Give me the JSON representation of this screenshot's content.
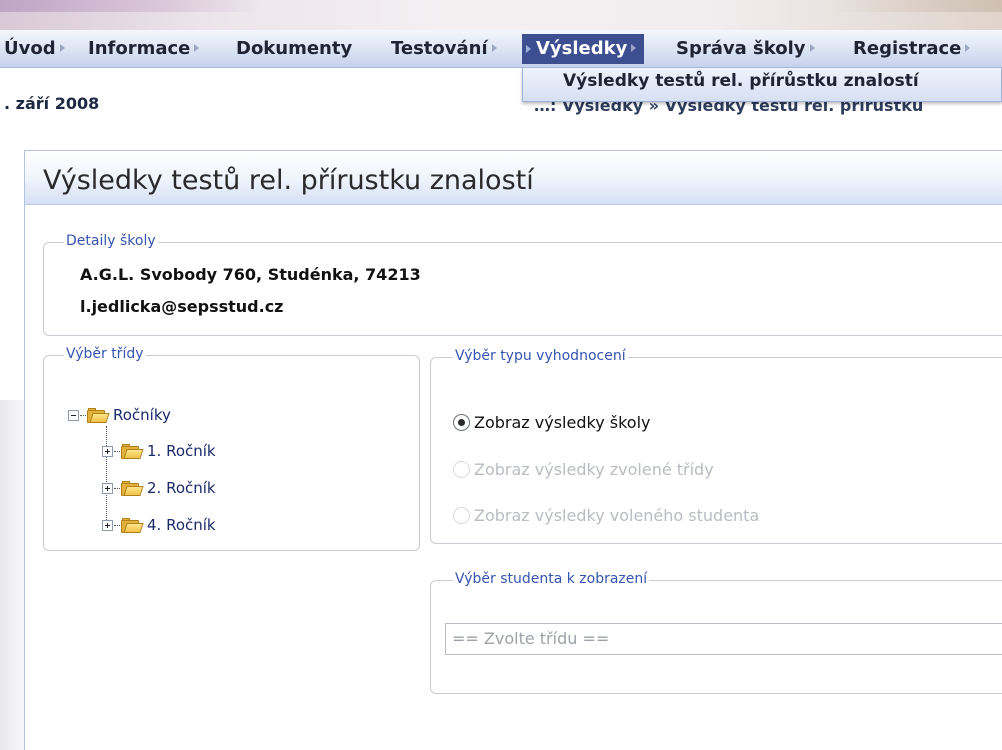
{
  "menu": {
    "items": [
      {
        "label": "Úvod"
      },
      {
        "label": "Informace"
      },
      {
        "label": "Dokumenty"
      },
      {
        "label": "Testování"
      },
      {
        "label": "Výsledky"
      },
      {
        "label": "Správa školy"
      },
      {
        "label": "Registrace"
      }
    ],
    "active": "Výsledky",
    "dropdown_item": "Výsledky testů rel. přírůstku znalostí"
  },
  "date": ". září 2008",
  "breadcrumb": "…: Výsledky » Výsledky testů rel. přírůstku",
  "page": {
    "title": "Výsledky testů rel. přírustku znalostí"
  },
  "school": {
    "legend": "Detaily školy",
    "address": "A.G.L. Svobody 760, Studénka, 74213",
    "email": "l.jedlicka@sepsstud.cz"
  },
  "class_select": {
    "legend": "Výběr třídy",
    "root": "Ročníky",
    "children": [
      "1. Ročník",
      "2. Ročník",
      "4. Ročník"
    ]
  },
  "evaluation": {
    "legend": "Výběr typu vyhodnocení",
    "options": [
      {
        "label": "Zobraz výsledky školy",
        "checked": true,
        "disabled": false
      },
      {
        "label": "Zobraz výsledky zvolené třídy",
        "checked": false,
        "disabled": true
      },
      {
        "label": "Zobraz výsledky voleného studenta",
        "checked": false,
        "disabled": true
      }
    ]
  },
  "student_select": {
    "legend": "Výběr studenta k zobrazení",
    "placeholder": "== Zvolte třídu =="
  },
  "colors": {
    "menu_active_bg": "#3d4f91",
    "legend_text": "#3555b0",
    "folder": "#e3b23c"
  }
}
